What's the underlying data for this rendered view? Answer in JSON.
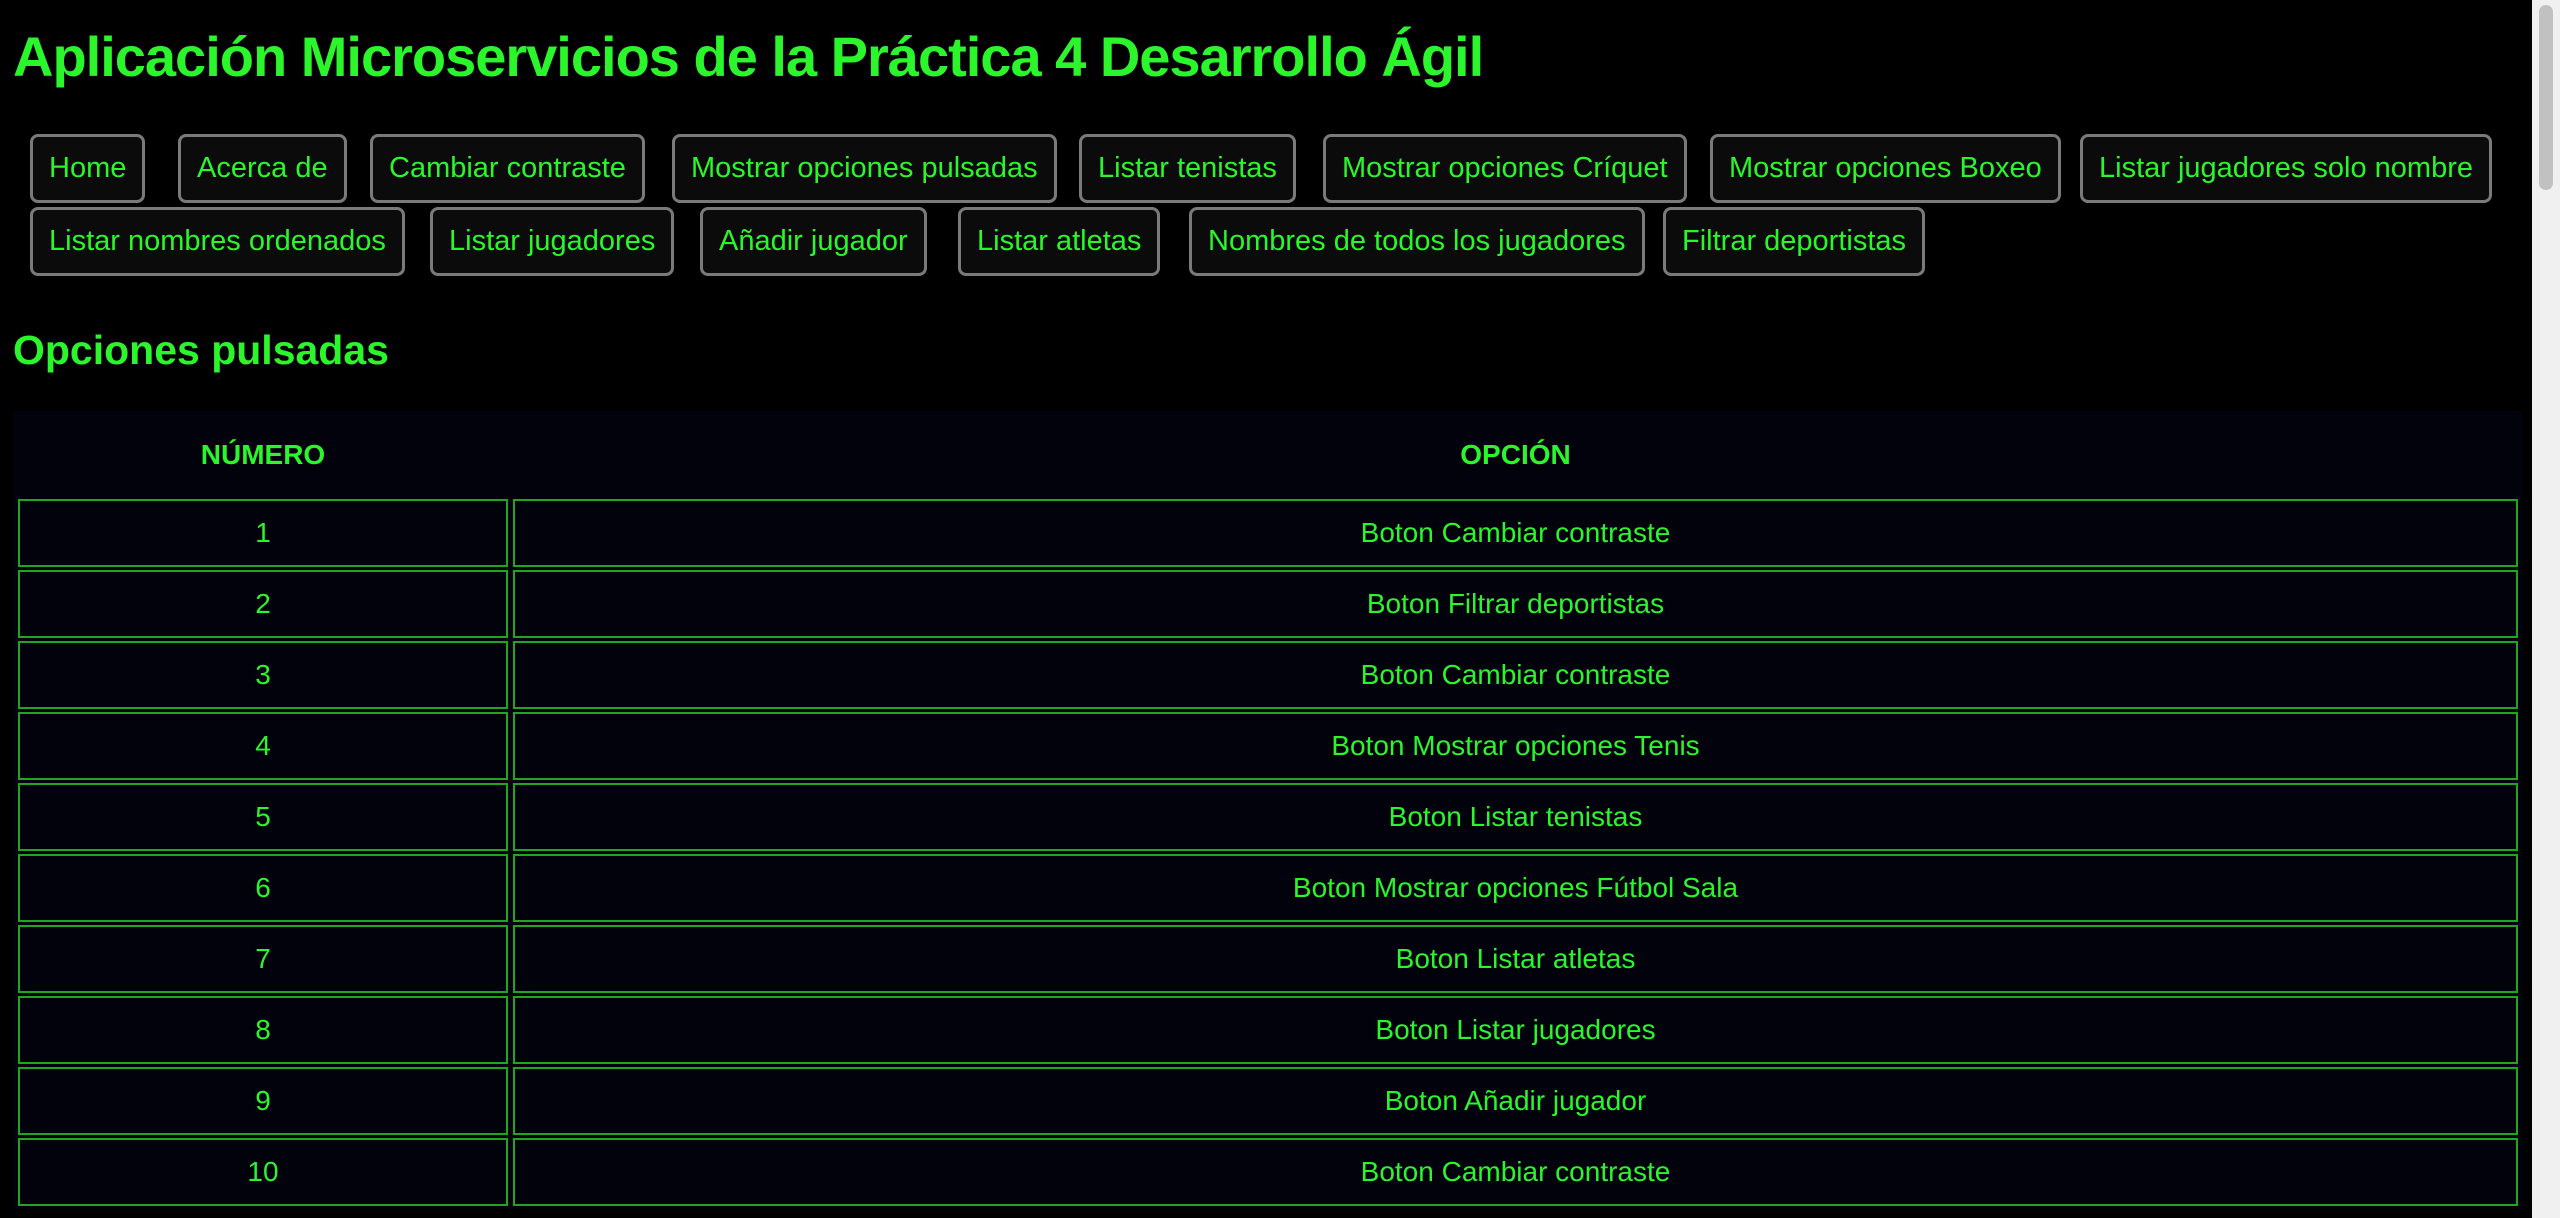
{
  "app_title": "Aplicación Microservicios de la Práctica 4 Desarrollo Ágil",
  "nav": {
    "row1": [
      {
        "label": "Home"
      },
      {
        "label": "Acerca de"
      },
      {
        "label": "Cambiar contraste"
      },
      {
        "label": "Mostrar opciones pulsadas"
      },
      {
        "label": "Listar tenistas"
      },
      {
        "label": "Mostrar opciones Críquet"
      },
      {
        "label": "Mostrar opciones Boxeo"
      },
      {
        "label": "Listar jugadores solo nombre"
      }
    ],
    "row2": [
      {
        "label": "Listar nombres ordenados"
      },
      {
        "label": "Listar jugadores"
      },
      {
        "label": "Añadir jugador"
      },
      {
        "label": "Listar atletas"
      },
      {
        "label": "Nombres de todos los jugadores"
      },
      {
        "label": "Filtrar deportistas"
      }
    ]
  },
  "section_title": "Opciones pulsadas",
  "table": {
    "headers": [
      "NÚMERO",
      "OPCIÓN"
    ],
    "rows": [
      {
        "number": "1",
        "option": "Boton Cambiar contraste"
      },
      {
        "number": "2",
        "option": "Boton Filtrar deportistas"
      },
      {
        "number": "3",
        "option": "Boton Cambiar contraste"
      },
      {
        "number": "4",
        "option": "Boton Mostrar opciones Tenis"
      },
      {
        "number": "5",
        "option": "Boton Listar tenistas"
      },
      {
        "number": "6",
        "option": "Boton Mostrar opciones Fútbol Sala"
      },
      {
        "number": "7",
        "option": "Boton Listar atletas"
      },
      {
        "number": "8",
        "option": "Boton Listar jugadores"
      },
      {
        "number": "9",
        "option": "Boton Añadir jugador"
      },
      {
        "number": "10",
        "option": "Boton Cambiar contraste"
      }
    ]
  },
  "colors": {
    "background": "#000000",
    "text": "#2bf52b",
    "button_border": "#7a7a7a",
    "cell_border": "#1fa51f"
  }
}
